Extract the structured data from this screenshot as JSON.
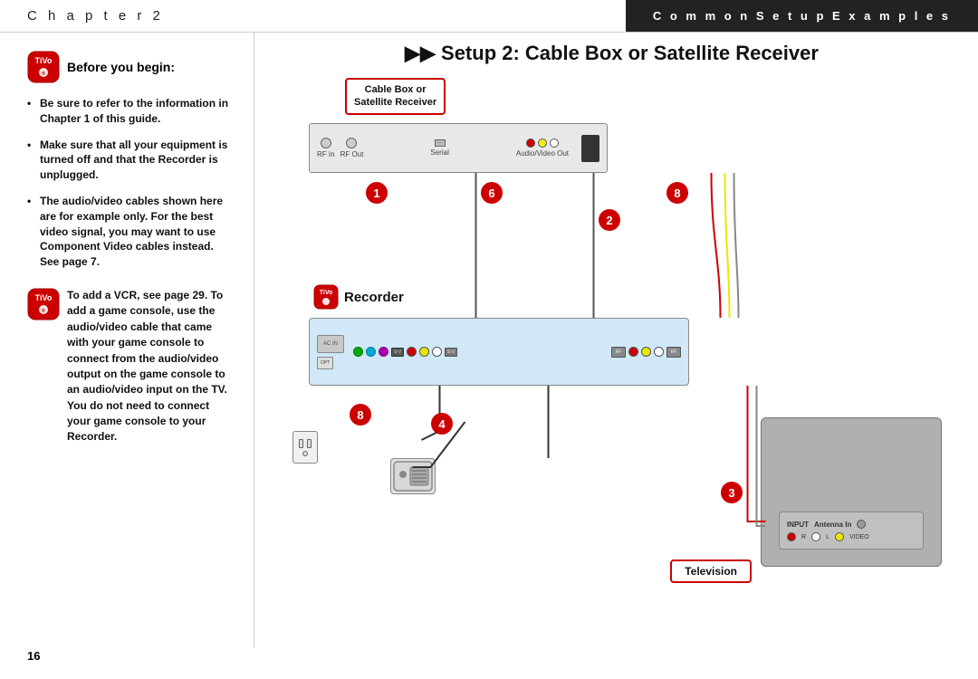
{
  "header": {
    "left": "C h a p t e r   2",
    "right": "C o m m o n   S e t u p   E x a m p l e s"
  },
  "page_title": {
    "arrows": "▶▶",
    "text": "Setup 2: Cable Box or Satellite Receiver"
  },
  "before_begin": {
    "title": "Before you begin:"
  },
  "bullets": [
    "Be sure to refer to the information in Chapter 1 of this guide.",
    "Make sure that all your equipment is turned off and that the Recorder is unplugged.",
    "The audio/video cables shown here are for example only. For the best video signal, you may want to use Component Video cables instead. See page 7."
  ],
  "vcr_note": "To add a VCR, see page 29. To add a game console, use the audio/video cable that came with your game console to connect from the audio/video output on the game console to an audio/video input on the TV. You do not need to connect your game console to your Recorder.",
  "cable_box_label": {
    "line1": "Cable Box or",
    "line2": "Satellite Receiver"
  },
  "recorder_label": "Recorder",
  "television_label": "Television",
  "page_number": "16",
  "ports": {
    "rf_in": "RF In",
    "rf_out": "RF Out",
    "serial": "Serial",
    "audio_video_out": "Audio/Video Out"
  },
  "numbers": [
    "1",
    "2",
    "3",
    "4",
    "6",
    "8"
  ],
  "tv_ports": {
    "input": "INPUT",
    "antenna_in": "Antenna In",
    "r": "R",
    "l": "L",
    "video": "VIDEO"
  }
}
